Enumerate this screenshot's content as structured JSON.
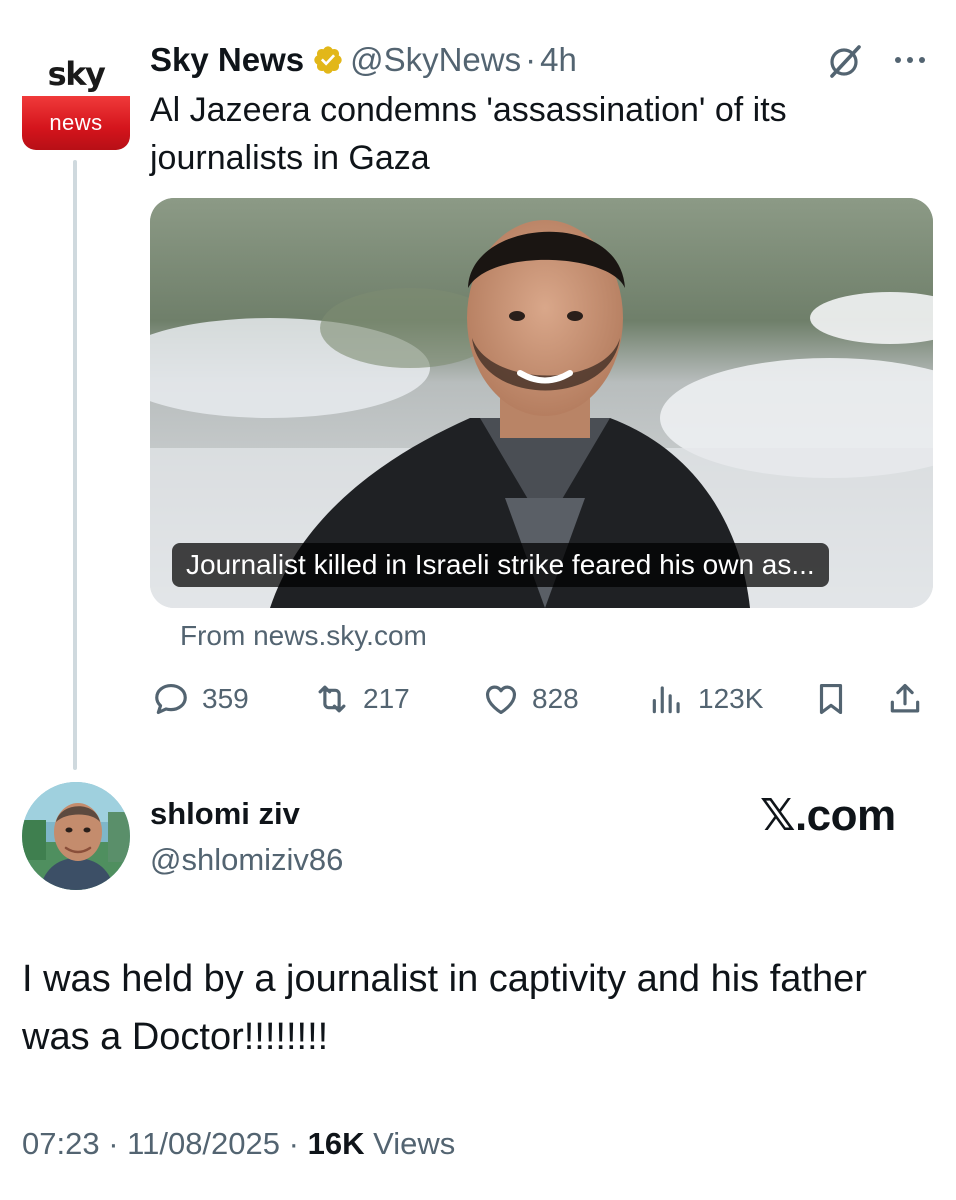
{
  "parent_tweet": {
    "avatar": {
      "logo_top": "sky",
      "logo_bottom": "news",
      "icon": "sky-news-logo"
    },
    "author_name": "Sky News",
    "verified_badge": "gold-verified-badge",
    "handle": "@SkyNews",
    "separator": "·",
    "time": "4h",
    "text": "Al Jazeera condemns 'assassination' of its journalists in Gaza",
    "link_card": {
      "image": "photo-of-journalist",
      "caption": "Journalist killed in Israeli strike feared his own as...",
      "source": "From news.sky.com"
    },
    "actions": {
      "replies": "359",
      "reposts": "217",
      "likes": "828",
      "views": "123K"
    },
    "icons": [
      "grok-icon",
      "more-icon",
      "reply-icon",
      "repost-icon",
      "like-icon",
      "views-icon",
      "bookmark-icon",
      "share-icon"
    ]
  },
  "reply_tweet": {
    "author_name": "shlomi ziv",
    "handle": "@shlomiziv86",
    "brand": "𝕏.com",
    "text": "I was held by a journalist in captivity and his father was a Doctor!!!!!!!!",
    "time": "07:23",
    "date": "11/08/2025",
    "separator": "·",
    "views_count": "16K",
    "views_label": "Views"
  },
  "colors": {
    "text_primary": "#0f1419",
    "text_secondary": "#536471",
    "thread_line": "#cfd9de",
    "verified_gold": "#e2b719",
    "sky_red": "#d4141c"
  }
}
